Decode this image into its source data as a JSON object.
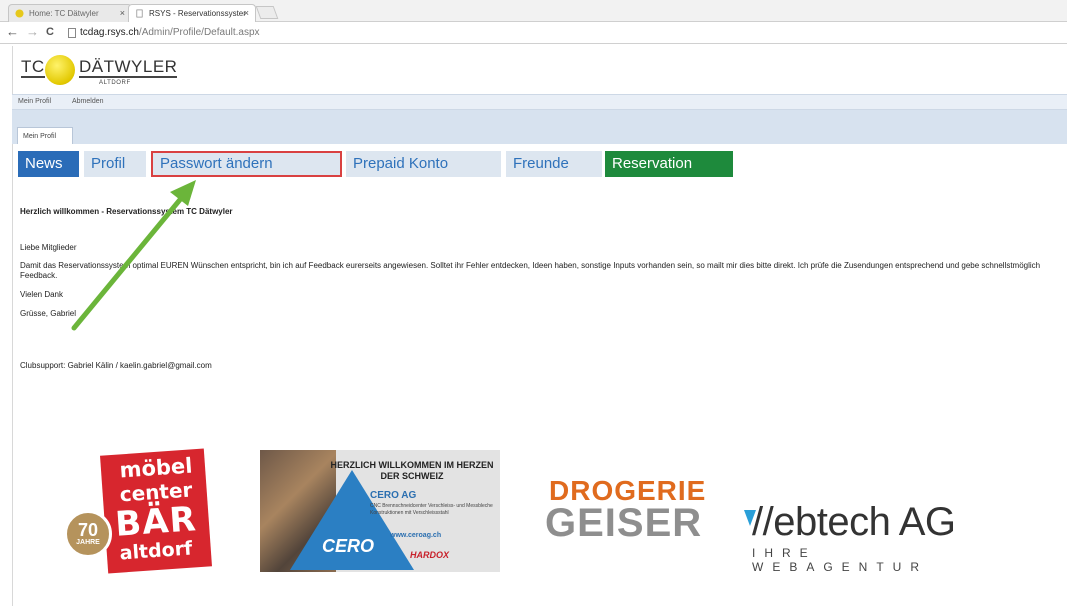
{
  "browser": {
    "tabs": [
      {
        "label": "Home: TC Dätwyler",
        "close": "×"
      },
      {
        "label": "RSYS - Reservationssyster",
        "close": "×"
      }
    ],
    "nav": {
      "back": "←",
      "forward": "→",
      "reload": "C"
    },
    "url": {
      "host": "tcdag.rsys.ch",
      "path": "/Admin/Profile/Default.aspx"
    }
  },
  "logo": {
    "left": "TC",
    "right": "DÄTWYLER",
    "sub": "ALTDORF"
  },
  "menu": {
    "items": [
      "Mein Profil",
      "Abmelden"
    ]
  },
  "subtab": {
    "label": "Mein Profil"
  },
  "function_tabs": [
    "News",
    "Profil",
    "Passwort ändern",
    "Prepaid Konto",
    "Freunde",
    "Reservation"
  ],
  "colors": {
    "news": "#2a6cb8",
    "reservation": "#1e8a3c",
    "highlight": "#d94141",
    "arrow": "#6bb53a"
  },
  "content": {
    "welcome": "Herzlich willkommen - Reservationssystem TC Dätwyler",
    "greeting": "Liebe Mitglieder",
    "paragraph": "Damit das Reservationssystem optimal EUREN Wünschen entspricht, bin ich auf Feedback eurerseits angewiesen. Solltet ihr Fehler entdecken, Ideen haben, sonstige Inputs vorhanden sein, so mailt mir dies bitte direkt. Ich prüfe die Zusendungen entsprechend und gebe schnellstmöglich Feedback.",
    "thanks": "Vielen Dank",
    "regards": "Grüsse, Gabriel",
    "support": "Clubsupport: Gabriel Kälin / kaelin.gabriel@gmail.com"
  },
  "sponsors": {
    "moebel": {
      "lines": [
        "möbel",
        "center",
        "BÄR",
        "altdorf"
      ],
      "badge_number": "70",
      "badge_text": "JAHRE"
    },
    "cero": {
      "headline": "HERZLICH WILLKOMMEN IM HERZEN DER SCHWEIZ",
      "name": "CERO AG",
      "desc": "CNC Brennschneidcenter Verschleiss- und Messbleche Konstruktionen mit Verschleissstahl",
      "url": "www.ceroag.ch",
      "logo": "CERO",
      "brand": "HARDOX"
    },
    "drogerie": {
      "line1": "DROGERIE",
      "line2": "GEISER"
    },
    "webtech": {
      "name": "//ebtech AG",
      "tagline": "IHRE WEBAGENTUR"
    }
  }
}
